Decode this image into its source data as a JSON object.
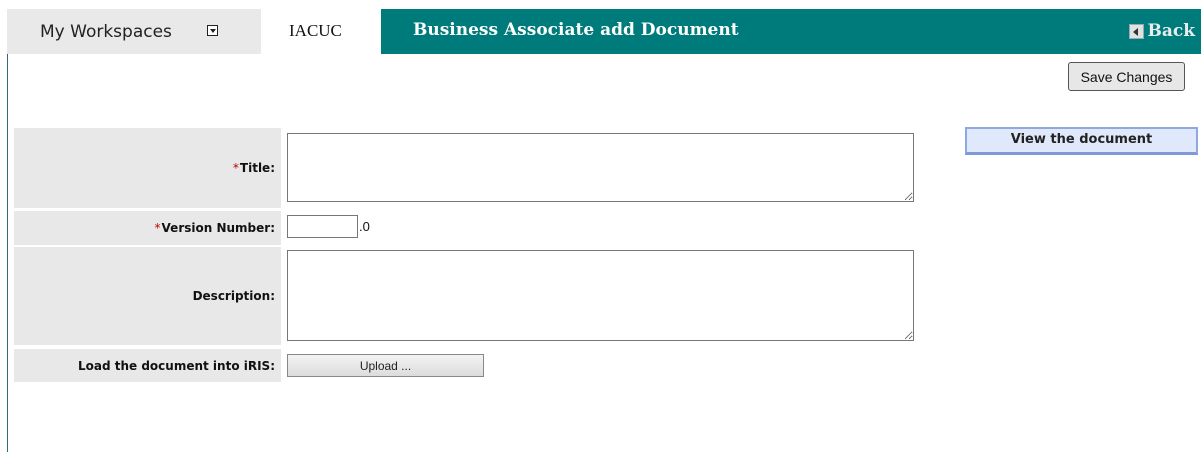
{
  "nav": {
    "workspaces_label": "My Workspaces",
    "module_tab_label": "IACUC",
    "page_title": "Business Associate add Document",
    "back_label": "Back"
  },
  "toolbar": {
    "save_label": "Save Changes"
  },
  "form": {
    "required_marker": "*",
    "title_label": "Title:",
    "title_value": "",
    "version_label": "Version Number:",
    "version_value": "",
    "version_suffix": ".0",
    "description_label": "Description:",
    "description_value": "",
    "load_label": "Load the document into iRIS:",
    "upload_label": "Upload ..."
  },
  "side": {
    "view_document_label": "View the document"
  },
  "colors": {
    "header_teal": "#007b7b",
    "required_red": "#c00000",
    "label_bg": "#e8e8e8",
    "view_button_bg": "#dfe9fb"
  },
  "icons": [
    "dropdown-arrow-icon",
    "back-arrow-icon"
  ]
}
